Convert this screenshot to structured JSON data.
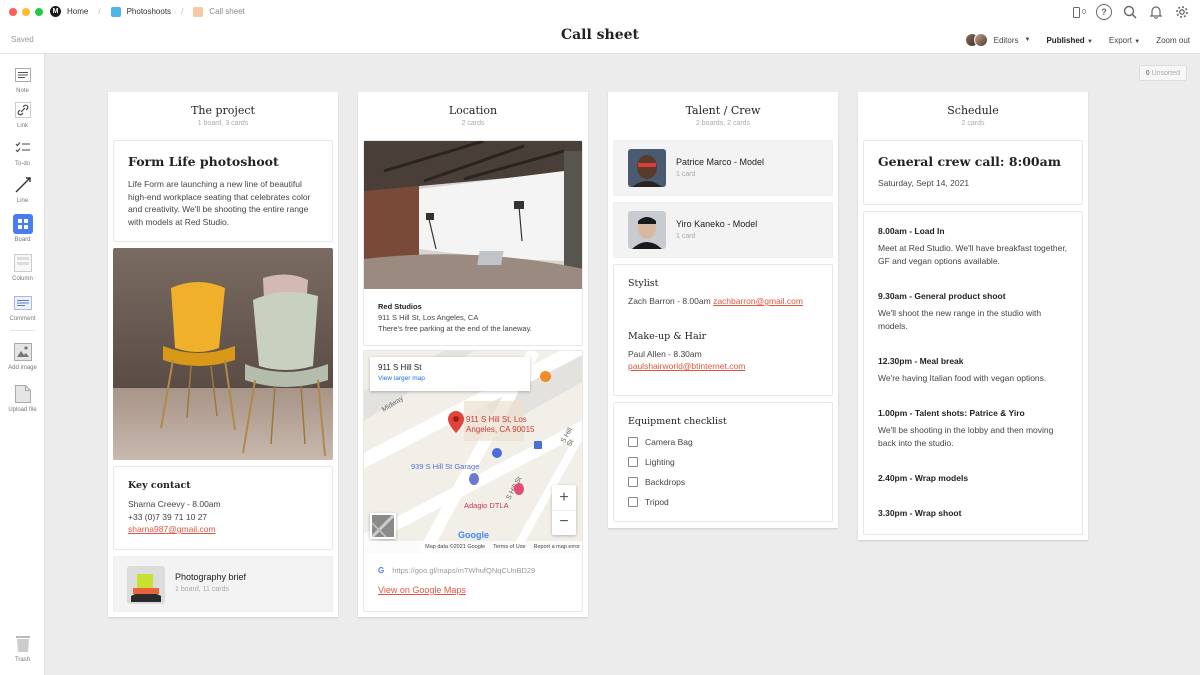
{
  "app": {
    "title": "Call sheet",
    "saved_status": "Saved",
    "breadcrumb": [
      {
        "label": "Home",
        "color": "#1a1a1a"
      },
      {
        "label": "Photoshoots",
        "color": "#4db8e8"
      },
      {
        "label": "Call sheet",
        "color": "#f5c9a8"
      }
    ],
    "device_count": "0",
    "editors_label": "Editors",
    "published_label": "Published",
    "export_label": "Export",
    "zoom_label": "Zoom out",
    "unsorted_count": "0",
    "unsorted_label": "Unsorted"
  },
  "toolbar": [
    {
      "label": "Note",
      "icon": "note-icon"
    },
    {
      "label": "Link",
      "icon": "link-icon"
    },
    {
      "label": "To-do",
      "icon": "todo-icon"
    },
    {
      "label": "Line",
      "icon": "line-icon"
    },
    {
      "label": "Board",
      "icon": "board-icon"
    },
    {
      "label": "Column",
      "icon": "column-icon"
    },
    {
      "label": "Comment",
      "icon": "comment-icon"
    },
    {
      "label": "Add image",
      "icon": "image-icon"
    },
    {
      "label": "Upload file",
      "icon": "file-icon"
    },
    {
      "label": "Trash",
      "icon": "trash-icon"
    }
  ],
  "project": {
    "title": "The project",
    "sub": "1 board, 3 cards",
    "heading": "Form Life photoshoot",
    "body": "Life Form are launching a new line of beautiful high-end workplace seating that celebrates color and creativity. We'll be shooting the entire range with models at Red Studio.",
    "key_contact_title": "Key contact",
    "contact_line1": "Sharna Creevy - 8.00am",
    "contact_line2": "+33 (0)7 39 71 10 27",
    "contact_email": "sharna987@gmail.com",
    "brief_title": "Photography brief",
    "brief_sub": "1 board, 11 cards"
  },
  "location": {
    "title": "Location",
    "sub": "2 cards",
    "studio_name": "Red Studios",
    "studio_address": "911 S Hill St, Los Angeles, CA",
    "studio_note": "There's free parking at the end of the laneway.",
    "map_popup_title": "911 S Hill St",
    "map_popup_link": "View larger map",
    "map_pin_label_1": "911 S Hill St, Los",
    "map_pin_label_2": "Angeles, CA 90015",
    "map_garage": "939 S Hill St Garage",
    "map_adagio": "Adagio DTLA",
    "map_street_1": "Midway",
    "map_street_2": "S Hill St",
    "map_street_3": "S Hill St",
    "map_footer_data": "Map data ©2021 Google",
    "map_footer_terms": "Terms of Use",
    "map_footer_report": "Report a map error",
    "map_google": "Google",
    "map_url": "https://goo.gl/maps/mTWhufQNqCUnBD29",
    "map_link": "View on Google Maps"
  },
  "talent": {
    "title": "Talent / Crew",
    "sub": "2 boards, 2 cards",
    "boards": [
      {
        "name": "Patrice Marco - Model",
        "sub": "1 card"
      },
      {
        "name": "Yiro Kaneko - Model",
        "sub": "1 card"
      }
    ],
    "stylist_title": "Stylist",
    "stylist_line": "Zach Barron  - 8.00am",
    "stylist_email": "zachbarron@gmail.com",
    "makeup_title": "Make-up & Hair",
    "makeup_line": "Paul Allen - 8.30am",
    "makeup_email": "paulshairworld@btinternet.com",
    "equipment_title": "Equipment checklist",
    "equipment": [
      "Camera Bag",
      "Lighting",
      "Backdrops",
      "Tripod"
    ]
  },
  "schedule": {
    "title": "Schedule",
    "sub": "2 cards",
    "call_heading": "General crew call: 8:00am",
    "call_date": "Saturday, Sept 14, 2021",
    "items": [
      {
        "time": "8.00am - Load In",
        "desc": "Meet at Red Studio. We'll have breakfast together, GF and vegan options available."
      },
      {
        "time": "9.30am - General product shoot",
        "desc": "We'll shoot the new range in the studio with models."
      },
      {
        "time": "12.30pm - Meal break",
        "desc": "We're having Italian food with vegan options."
      },
      {
        "time": "1.00pm - Talent shots: Patrice & Yiro",
        "desc": "We'll be shooting in the lobby and then moving back into the studio."
      },
      {
        "time": "2.40pm - Wrap models",
        "desc": ""
      },
      {
        "time": "3.30pm - Wrap shoot",
        "desc": ""
      }
    ]
  },
  "colors": {
    "accent_link": "#e0563f",
    "board_icon": "#4a7cf0",
    "pin": "#e0443a"
  }
}
